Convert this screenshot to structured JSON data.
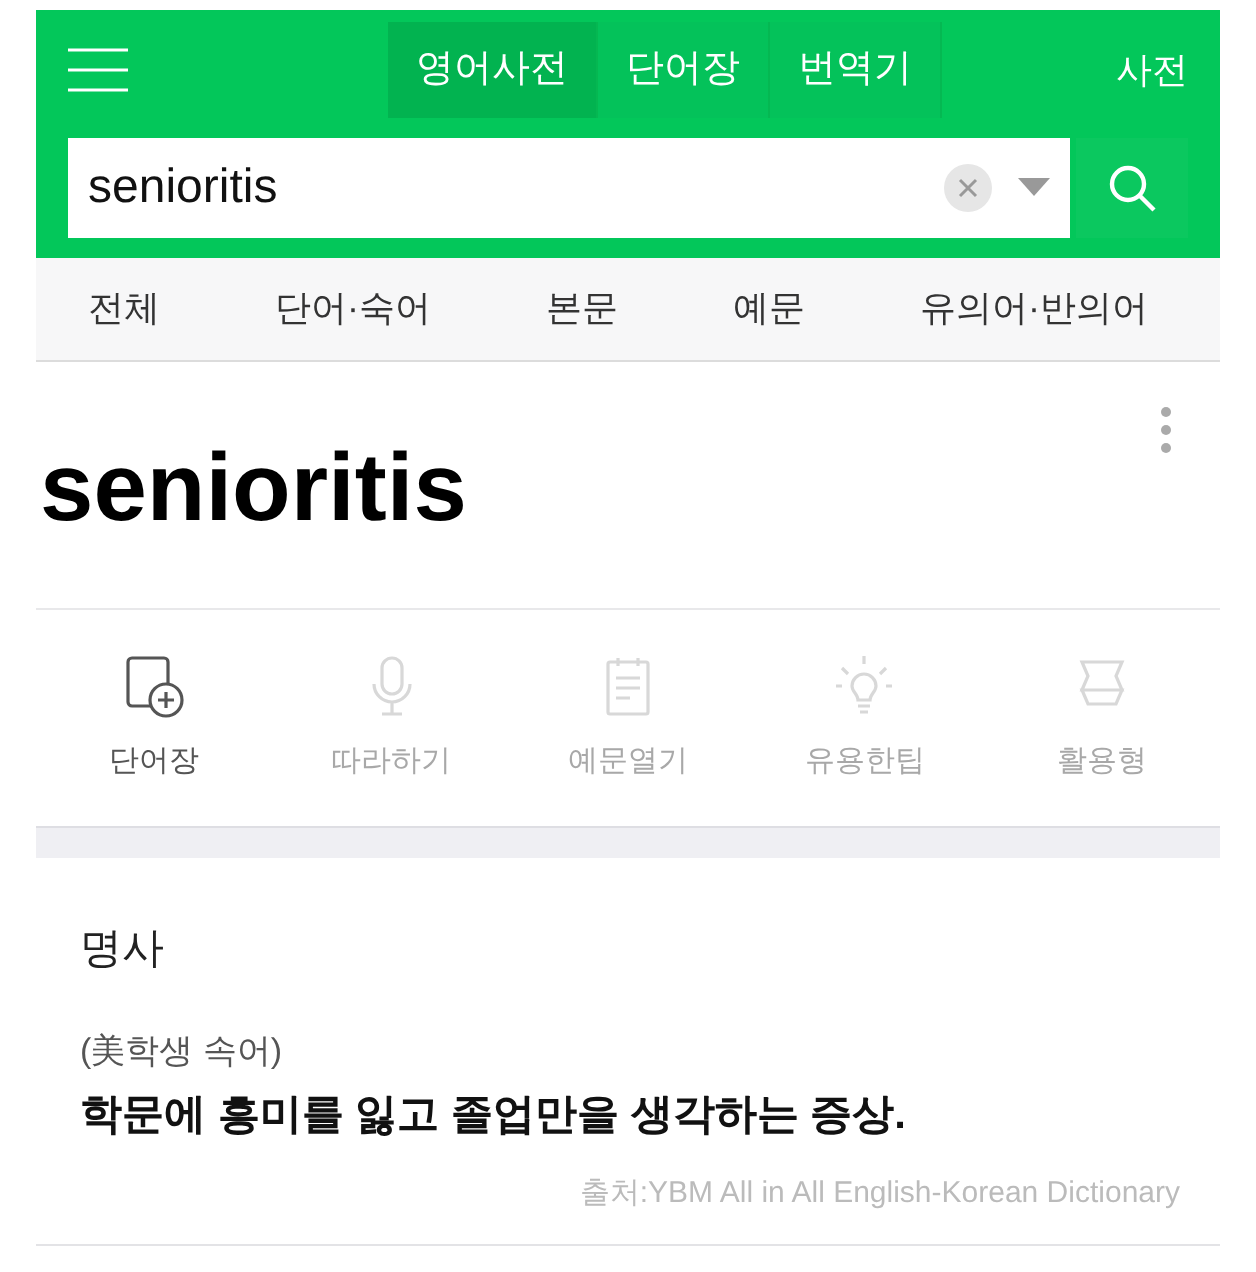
{
  "header": {
    "tabs": [
      {
        "label": "영어사전",
        "selected": true
      },
      {
        "label": "단어장",
        "selected": false
      },
      {
        "label": "번역기",
        "selected": false
      }
    ],
    "right_link": "사전"
  },
  "search": {
    "value": "senioritis"
  },
  "filters": [
    "전체",
    "단어·숙어",
    "본문",
    "예문",
    "유의어·반의어"
  ],
  "entry": {
    "word": "senioritis"
  },
  "tools": [
    {
      "kind": "wordbook",
      "label": "단어장",
      "disabled": false
    },
    {
      "kind": "mic",
      "label": "따라하기",
      "disabled": true
    },
    {
      "kind": "notes",
      "label": "예문열기",
      "disabled": true
    },
    {
      "kind": "bulb",
      "label": "유용한팁",
      "disabled": true
    },
    {
      "kind": "forms",
      "label": "활용형",
      "disabled": true
    }
  ],
  "meaning": {
    "part_of_speech": "명사",
    "note": "(美학생 속어)",
    "definition": "학문에 흥미를 잃고 졸업만을 생각하는 증상.",
    "source": "출처:YBM All in All English-Korean Dictionary"
  }
}
